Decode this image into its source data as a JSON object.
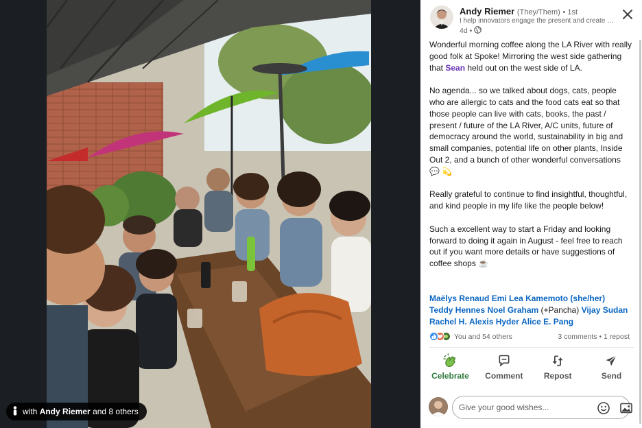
{
  "viewer": {
    "tag_prefix": "with",
    "tag_name": "Andy Riemer",
    "tag_suffix": "and 8 others"
  },
  "author": {
    "name": "Andy Riemer",
    "pronouns": "(They/Them)",
    "degree": "• 1st",
    "headline": "I help innovators engage the present and create the future",
    "time": "4d •"
  },
  "post": {
    "p1_before": "Wonderful morning coffee along the LA River with really good folk at Spoke! Mirroring the west side gathering that ",
    "p1_mention": "Sean",
    "p1_after": " held out on the west side of LA.",
    "p2": "No agenda... so we talked about dogs, cats, people who are allergic to cats and the food cats eat so that those people can live with cats, books, the past / present / future of the LA River, A/C units, future of democracy around the world, sustainability in big and small companies, potential life on other plants, Inside Out 2, and a bunch of other wonderful conversations 💬 💫",
    "p3": "Really grateful to continue to find insightful, thoughtful, and kind people in my life like the people below!",
    "p4": "Such a excellent way to start a Friday and looking forward to doing it again in August - feel free to reach out if you want more details or have suggestions of coffee shops ☕"
  },
  "tags": {
    "t1": "Maëlys Renaud",
    "t2": "Emi Lea Kamemoto (she/her)",
    "t3": "Teddy Hennes",
    "t4": "Noel Graham",
    "t4_extra": " (+Pancha) ",
    "t5": "Vijay Sudan",
    "t6": "Rachel H.",
    "t7": "Alexis Hyder",
    "t8": "Alice E. Pang"
  },
  "social": {
    "reactions_label": "You and 54 others",
    "counts": "3 comments • 1 repost"
  },
  "actions": {
    "celebrate": "Celebrate",
    "comment": "Comment",
    "repost": "Repost",
    "send": "Send"
  },
  "comment_box": {
    "placeholder": "Give your good wishes..."
  },
  "icons": {
    "close": "close-icon",
    "globe": "globe-icon",
    "celebrate": "celebrate-icon",
    "comment": "comment-icon",
    "repost": "repost-icon",
    "send": "send-icon",
    "emoji": "emoji-icon",
    "image": "image-icon"
  },
  "colors": {
    "link": "#0a66c2",
    "mention": "#6a35b5",
    "celebrate_active": "#2e7a3c",
    "viewer_bg": "#1b1f23"
  }
}
